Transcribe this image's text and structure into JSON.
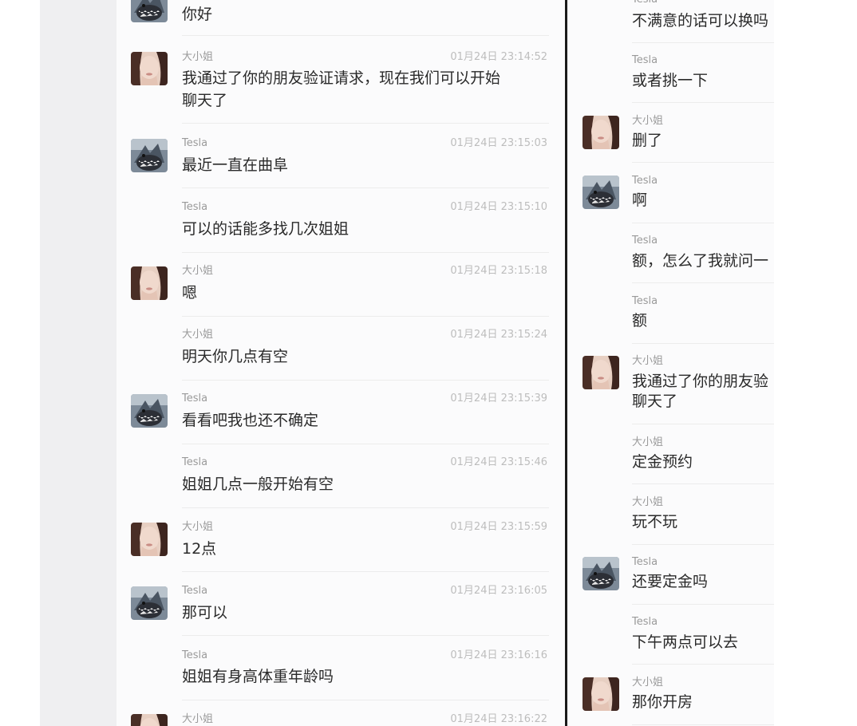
{
  "left_chat": {
    "messages": [
      {
        "sender": "",
        "time": "",
        "text": "你好",
        "avatar": "shark"
      },
      {
        "sender": "大小姐",
        "time": "01月24日 23:14:52",
        "text": "我通过了你的朋友验证请求，现在我们可以开始",
        "text2": "聊天了",
        "avatar": "girl"
      },
      {
        "sender": "Tesla",
        "time": "01月24日 23:15:03",
        "text": "最近一直在曲阜",
        "avatar": "shark"
      },
      {
        "sender": "Tesla",
        "time": "01月24日 23:15:10",
        "text": "可以的话能多找几次姐姐",
        "avatar": ""
      },
      {
        "sender": "大小姐",
        "time": "01月24日 23:15:18",
        "text": "嗯",
        "avatar": "girl"
      },
      {
        "sender": "大小姐",
        "time": "01月24日 23:15:24",
        "text": "明天你几点有空",
        "avatar": ""
      },
      {
        "sender": "Tesla",
        "time": "01月24日 23:15:39",
        "text": "看看吧我也还不确定",
        "avatar": "shark"
      },
      {
        "sender": "Tesla",
        "time": "01月24日 23:15:46",
        "text": "姐姐几点一般开始有空",
        "avatar": ""
      },
      {
        "sender": "大小姐",
        "time": "01月24日 23:15:59",
        "text": "12点",
        "avatar": "girl"
      },
      {
        "sender": "Tesla",
        "time": "01月24日 23:16:05",
        "text": "那可以",
        "avatar": "shark"
      },
      {
        "sender": "Tesla",
        "time": "01月24日 23:16:16",
        "text": "姐姐有身高体重年龄吗",
        "avatar": ""
      },
      {
        "sender": "大小姐",
        "time": "01月24日 23:16:22",
        "text": "",
        "avatar": "girl"
      }
    ]
  },
  "right_chat": {
    "messages": [
      {
        "sender": "Tesla",
        "text": "不满意的话可以换吗",
        "avatar": ""
      },
      {
        "sender": "Tesla",
        "text": "或者挑一下",
        "avatar": ""
      },
      {
        "sender": "大小姐",
        "text": "删了",
        "avatar": "girl"
      },
      {
        "sender": "Tesla",
        "text": "啊",
        "avatar": "shark"
      },
      {
        "sender": "Tesla",
        "text": "额，怎么了我就问一",
        "avatar": ""
      },
      {
        "sender": "Tesla",
        "text": "额",
        "avatar": ""
      },
      {
        "sender": "大小姐",
        "text": "我通过了你的朋友验",
        "text2": "聊天了",
        "avatar": "girl"
      },
      {
        "sender": "大小姐",
        "text": "定金预约",
        "avatar": ""
      },
      {
        "sender": "大小姐",
        "text": "玩不玩",
        "avatar": ""
      },
      {
        "sender": "Tesla",
        "text": "还要定金吗",
        "avatar": "shark"
      },
      {
        "sender": "Tesla",
        "text": "下午两点可以去",
        "avatar": ""
      },
      {
        "sender": "大小姐",
        "text": "那你开房",
        "avatar": "girl"
      }
    ]
  },
  "avatar_icons": {
    "shark": "shark-avatar-icon",
    "girl": "girl-avatar-icon"
  },
  "colors": {
    "panel_bg": "#fbfbfc",
    "gutter_bg": "#efeff1",
    "divider": "#1a1a1a",
    "name_text": "#9a9a9a",
    "time_text": "#bdbdbd",
    "message_text": "#2a2a2a"
  }
}
